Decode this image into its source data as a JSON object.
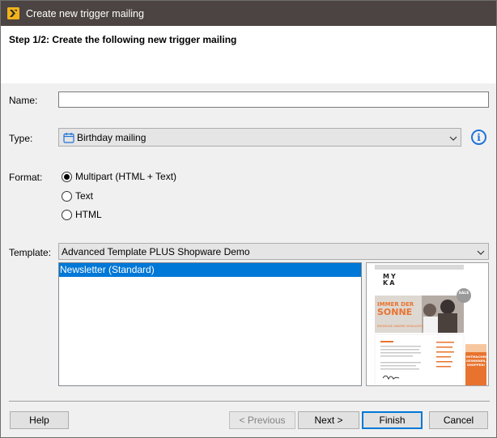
{
  "window": {
    "title": "Create new trigger mailing"
  },
  "header": {
    "step_title": "Step 1/2: Create the following new trigger mailing"
  },
  "form": {
    "name_label": "Name:",
    "name_value": "",
    "type_label": "Type:",
    "type_value": "Birthday mailing",
    "format_label": "Format:",
    "format_options": [
      {
        "label": "Multipart (HTML + Text)",
        "selected": true
      },
      {
        "label": "Text",
        "selected": false
      },
      {
        "label": "HTML",
        "selected": false
      }
    ],
    "template_label": "Template:",
    "template_value": "Advanced Template PLUS Shopware Demo",
    "template_list": [
      {
        "label": "Newsletter (Standard)",
        "selected": true
      }
    ]
  },
  "preview": {
    "logo_line1": "MY",
    "logo_line2": "KA",
    "headline1": "IMMER DER",
    "headline2": "SONNE",
    "subline": "ENTDECKE UNSERE HIGHLIGHTS",
    "badge": "SALE",
    "promo1": "MITMACHEN,",
    "promo2": "GEWINNEN,",
    "promo3": "SHOPPEN!"
  },
  "buttons": {
    "help": "Help",
    "previous": "< Previous",
    "next": "Next >",
    "finish": "Finish",
    "cancel": "Cancel"
  },
  "colors": {
    "titlebar": "#4b4442",
    "accent": "#0078d7",
    "brand": "#f2b21a",
    "preview_orange": "#e8732f"
  }
}
